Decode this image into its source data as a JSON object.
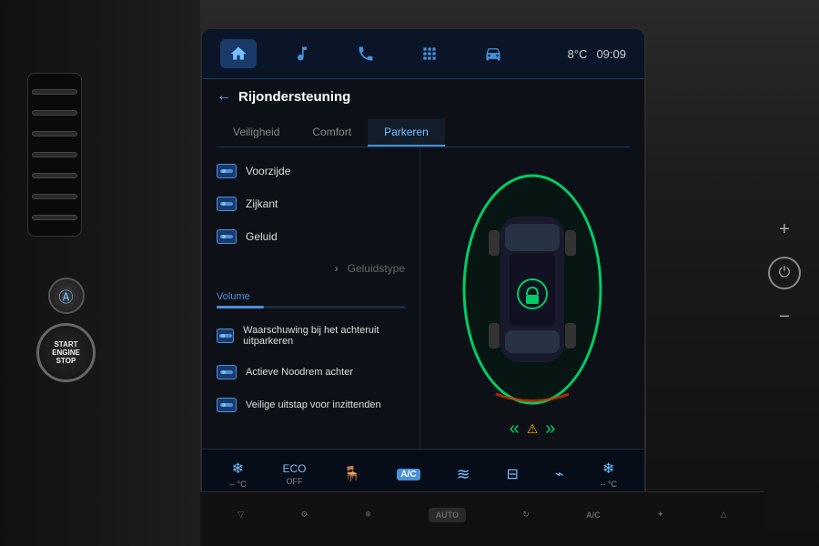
{
  "screen": {
    "title": "Rijondersteuning",
    "back_label": "←",
    "temperature": "8°C",
    "time": "09:09",
    "tabs": [
      {
        "id": "veiligheid",
        "label": "Veiligheid",
        "active": false
      },
      {
        "id": "comfort",
        "label": "Comfort",
        "active": false
      },
      {
        "id": "parkeren",
        "label": "Parkeren",
        "active": true
      }
    ],
    "nav_icons": [
      {
        "id": "home",
        "label": "home",
        "active": true
      },
      {
        "id": "music",
        "label": "music",
        "active": false
      },
      {
        "id": "phone",
        "label": "phone",
        "active": false
      },
      {
        "id": "apps",
        "label": "apps",
        "active": false
      },
      {
        "id": "car",
        "label": "car",
        "active": false
      }
    ],
    "menu_items": [
      {
        "id": "voorzijde",
        "label": "Voorzijde",
        "has_icon": true,
        "disabled": false
      },
      {
        "id": "zijkant",
        "label": "Zijkant",
        "has_icon": true,
        "disabled": false
      },
      {
        "id": "geluid",
        "label": "Geluid",
        "has_icon": true,
        "disabled": false
      },
      {
        "id": "geluidstype",
        "label": "Geluidstype",
        "has_icon": false,
        "has_chevron": true,
        "disabled": true
      }
    ],
    "volume_label": "Volume",
    "volume_percent": 25,
    "menu_items_2": [
      {
        "id": "waarschuwing",
        "label": "Waarschuwing bij het achteruit uitparkeren",
        "has_icon": true
      },
      {
        "id": "noodrem",
        "label": "Actieve Noodrem achter",
        "has_icon": true
      },
      {
        "id": "uitstap",
        "label": "Veilige uitstap voor inzittenden",
        "has_icon": true
      }
    ],
    "bottom_controls": [
      {
        "id": "temp-left",
        "label": "-- °C",
        "icon": "❄"
      },
      {
        "id": "eco-off",
        "label": "ECO OFF",
        "icon": "🌿"
      },
      {
        "id": "seat-heat",
        "label": "",
        "icon": "⊕"
      },
      {
        "id": "seat-icon",
        "label": "",
        "icon": "🪑"
      },
      {
        "id": "ac",
        "label": "A/C",
        "icon": "A/C"
      },
      {
        "id": "defrost",
        "label": "",
        "icon": "≋"
      },
      {
        "id": "rear-window",
        "label": "",
        "icon": "⊟"
      },
      {
        "id": "mirror",
        "label": "",
        "icon": "≺"
      },
      {
        "id": "temp-right",
        "label": "-- °C",
        "icon": "❄"
      }
    ]
  },
  "physical_controls": {
    "plus": "+",
    "power": "⏻",
    "minus": "−",
    "bottom_row": [
      {
        "id": "fan-down",
        "label": "▽"
      },
      {
        "id": "settings",
        "label": "⚙"
      },
      {
        "id": "snowflake",
        "label": "❄"
      },
      {
        "id": "auto",
        "label": "AUTO"
      },
      {
        "id": "recycle",
        "label": "↻"
      },
      {
        "id": "ac-bottom",
        "label": "A/C"
      },
      {
        "id": "snowflake2",
        "label": "❄✦"
      },
      {
        "id": "fan-up",
        "label": "△"
      }
    ]
  },
  "start_stop": {
    "label": "START\nENGINE\nSTOP"
  }
}
